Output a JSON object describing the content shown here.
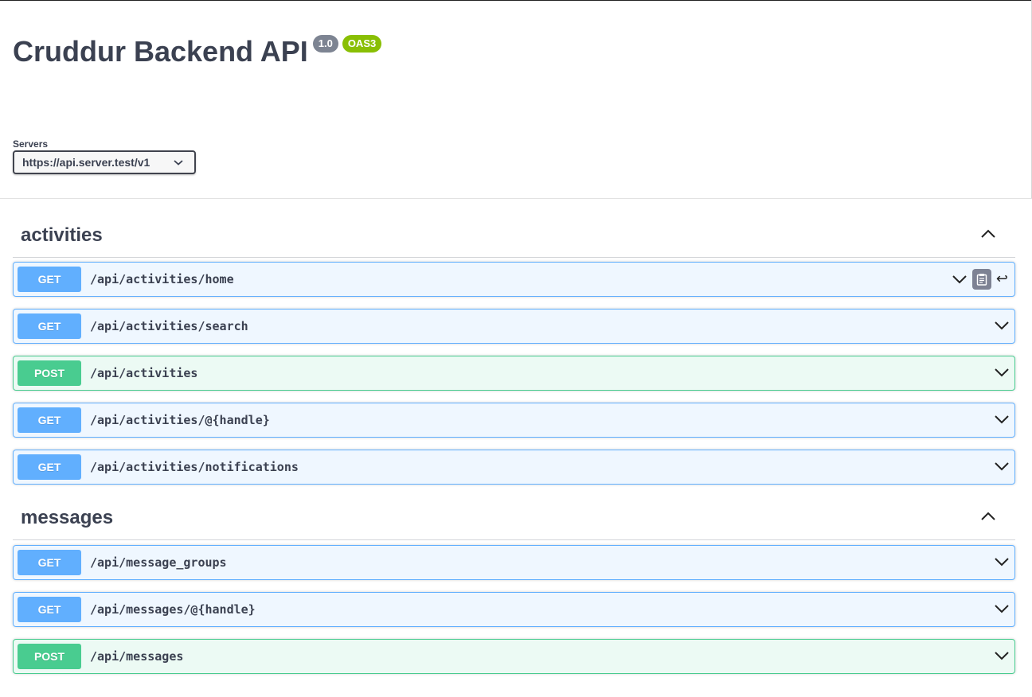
{
  "info": {
    "title": "Cruddur Backend API",
    "version": "1.0",
    "oas_badge": "OAS3"
  },
  "servers": {
    "label": "Servers",
    "selected": "https://api.server.test/v1"
  },
  "tags": [
    {
      "name": "activities",
      "operations": [
        {
          "method": "GET",
          "path": "/api/activities/home"
        },
        {
          "method": "GET",
          "path": "/api/activities/search"
        },
        {
          "method": "POST",
          "path": "/api/activities"
        },
        {
          "method": "GET",
          "path": "/api/activities/@{handle}"
        },
        {
          "method": "GET",
          "path": "/api/activities/notifications"
        }
      ]
    },
    {
      "name": "messages",
      "operations": [
        {
          "method": "GET",
          "path": "/api/message_groups"
        },
        {
          "method": "GET",
          "path": "/api/messages/@{handle}"
        },
        {
          "method": "POST",
          "path": "/api/messages"
        }
      ]
    }
  ],
  "colors": {
    "get": "#61affe",
    "post": "#49cc90",
    "oas_badge": "#89bf04",
    "version_badge": "#7d8492"
  },
  "icons": {
    "expand": "chevron-down-icon",
    "collapse": "chevron-up-icon",
    "copy": "clipboard-icon",
    "return": "return-arrow-icon"
  }
}
